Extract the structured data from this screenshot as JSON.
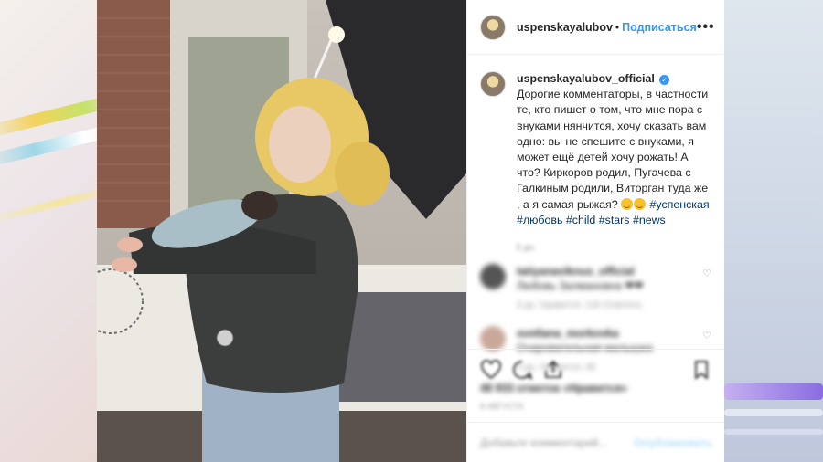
{
  "post": {
    "header": {
      "username": "uspenskayalubov_official",
      "username_short": "uspenskayalubov",
      "separator": "•",
      "follow_label": "Подписаться",
      "more_label": "•••"
    },
    "caption": {
      "username": "uspenskayalubov_official",
      "text": "Дорогие комментаторы, в частности те, кто пишет о том, что мне пора с внуками нянчится, хочу сказать вам одно: вы не спешите с внуками, я может ещё детей хочу рожать! А что? Киркоров родил, Пугачева с Галкиным родили, Виторган туда же , а я самая рыжая?",
      "hashtags": [
        "#успенская",
        "#любовь",
        "#child",
        "#stars",
        "#news"
      ],
      "time": "3 дн."
    },
    "comments": [
      {
        "username": "tatiyanaviknus_official",
        "text": "Любовь Залмановна ❤❤",
        "meta": "3 дн.   Нравится: 126   Ответить"
      },
      {
        "username": "svetlana_morkovka",
        "text": "Очаровательная малышка",
        "meta": "3 дн.   Нравится: 48"
      }
    ],
    "likes": "48 933 отметок «Нравится»",
    "date": "8 АВГУСТА",
    "add_comment_placeholder": "Добавьте комментарий...",
    "publish_label": "Опубликовать"
  },
  "colors": {
    "accent": "#3897f0",
    "text": "#262626",
    "muted": "#999999",
    "hashtag": "#003569"
  },
  "icons": [
    "more-icon",
    "verified-icon",
    "heart-icon",
    "comment-icon",
    "share-icon",
    "bookmark-icon"
  ]
}
